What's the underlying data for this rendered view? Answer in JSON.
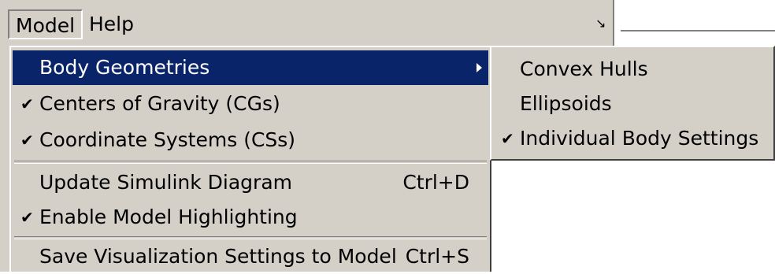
{
  "menubar": {
    "menus": [
      {
        "label": "Model"
      },
      {
        "label": "Help"
      }
    ]
  },
  "model_menu": {
    "items": [
      {
        "label": "Body Geometries",
        "checked": false,
        "has_submenu": true,
        "highlighted": true
      },
      {
        "label": "Centers of Gravity (CGs)",
        "checked": true
      },
      {
        "label": "Coordinate Systems (CSs)",
        "checked": true
      },
      {
        "label": "Update Simulink Diagram",
        "accelerator": "Ctrl+D",
        "checked": false
      },
      {
        "label": "Enable Model Highlighting",
        "checked": true
      },
      {
        "label": "Save Visualization Settings to Model",
        "accelerator": "Ctrl+S",
        "checked": false
      }
    ]
  },
  "body_geometries_submenu": {
    "items": [
      {
        "label": "Convex Hulls",
        "checked": false
      },
      {
        "label": "Ellipsoids",
        "checked": false
      },
      {
        "label": "Individual Body Settings",
        "checked": true
      }
    ]
  },
  "colors": {
    "menu_bg": "#d4d0c8",
    "highlight_bg": "#0a246a",
    "highlight_text": "#ffffff"
  }
}
